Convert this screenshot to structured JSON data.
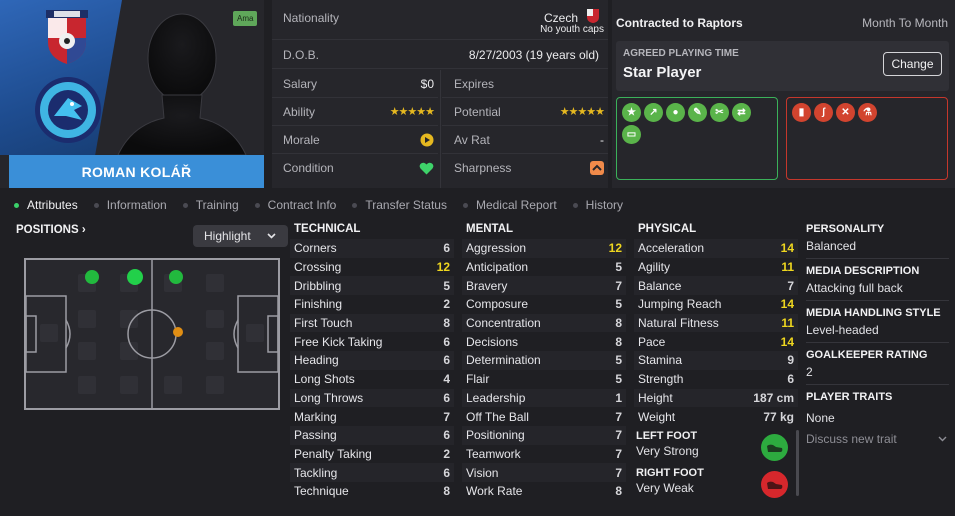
{
  "player": {
    "name": "ROMAN KOLÁŘ",
    "tag": "Ama"
  },
  "info": {
    "nationality_label": "Nationality",
    "nationality": "Czech",
    "caps": "No youth caps",
    "dob_label": "D.O.B.",
    "dob": "8/27/2003 (19 years old)",
    "salary_label": "Salary",
    "salary": "$0",
    "expires_label": "Expires",
    "ability_label": "Ability",
    "potential_label": "Potential",
    "ability_stars": "★★★★★",
    "potential_stars": "★★★★★",
    "morale_label": "Morale",
    "avrat_label": "Av Rat",
    "avrat": "-",
    "condition_label": "Condition",
    "sharpness_label": "Sharpness"
  },
  "contract": {
    "title": "Contracted to Raptors",
    "type": "Month To Month",
    "playing_time_label": "AGREED PLAYING TIME",
    "playing_time": "Star Player",
    "change_label": "Change"
  },
  "tabs": [
    "Attributes",
    "Information",
    "Training",
    "Contract Info",
    "Transfer Status",
    "Medical Report",
    "History"
  ],
  "positions": {
    "title": "POSITIONS ›",
    "highlight": "Highlight"
  },
  "technical": {
    "header": "TECHNICAL",
    "rows": [
      {
        "name": "Corners",
        "value": "6",
        "hl": false
      },
      {
        "name": "Crossing",
        "value": "12",
        "hl": true
      },
      {
        "name": "Dribbling",
        "value": "5",
        "hl": false
      },
      {
        "name": "Finishing",
        "value": "2",
        "hl": false
      },
      {
        "name": "First Touch",
        "value": "8",
        "hl": false
      },
      {
        "name": "Free Kick Taking",
        "value": "6",
        "hl": false
      },
      {
        "name": "Heading",
        "value": "6",
        "hl": false
      },
      {
        "name": "Long Shots",
        "value": "4",
        "hl": false
      },
      {
        "name": "Long Throws",
        "value": "6",
        "hl": false
      },
      {
        "name": "Marking",
        "value": "7",
        "hl": false
      },
      {
        "name": "Passing",
        "value": "6",
        "hl": false
      },
      {
        "name": "Penalty Taking",
        "value": "2",
        "hl": false
      },
      {
        "name": "Tackling",
        "value": "6",
        "hl": false
      },
      {
        "name": "Technique",
        "value": "8",
        "hl": false
      }
    ]
  },
  "mental": {
    "header": "MENTAL",
    "rows": [
      {
        "name": "Aggression",
        "value": "12",
        "hl": true
      },
      {
        "name": "Anticipation",
        "value": "5",
        "hl": false
      },
      {
        "name": "Bravery",
        "value": "7",
        "hl": false
      },
      {
        "name": "Composure",
        "value": "5",
        "hl": false
      },
      {
        "name": "Concentration",
        "value": "8",
        "hl": false
      },
      {
        "name": "Decisions",
        "value": "8",
        "hl": false
      },
      {
        "name": "Determination",
        "value": "5",
        "hl": false
      },
      {
        "name": "Flair",
        "value": "5",
        "hl": false
      },
      {
        "name": "Leadership",
        "value": "1",
        "hl": false
      },
      {
        "name": "Off The Ball",
        "value": "7",
        "hl": false
      },
      {
        "name": "Positioning",
        "value": "7",
        "hl": false
      },
      {
        "name": "Teamwork",
        "value": "7",
        "hl": false
      },
      {
        "name": "Vision",
        "value": "7",
        "hl": false
      },
      {
        "name": "Work Rate",
        "value": "8",
        "hl": false
      }
    ]
  },
  "physical": {
    "header": "PHYSICAL",
    "rows": [
      {
        "name": "Acceleration",
        "value": "14",
        "hl": true
      },
      {
        "name": "Agility",
        "value": "11",
        "hl": true
      },
      {
        "name": "Balance",
        "value": "7",
        "hl": false
      },
      {
        "name": "Jumping Reach",
        "value": "14",
        "hl": true
      },
      {
        "name": "Natural Fitness",
        "value": "11",
        "hl": true
      },
      {
        "name": "Pace",
        "value": "14",
        "hl": true
      },
      {
        "name": "Stamina",
        "value": "9",
        "hl": false
      },
      {
        "name": "Strength",
        "value": "6",
        "hl": false
      },
      {
        "name": "Height",
        "value": "187 cm",
        "hl": false
      },
      {
        "name": "Weight",
        "value": "77 kg",
        "hl": false
      }
    ]
  },
  "feet": {
    "left_label": "LEFT FOOT",
    "left_value": "Very Strong",
    "right_label": "RIGHT FOOT",
    "right_value": "Very Weak"
  },
  "right": {
    "personality_label": "PERSONALITY",
    "personality": "Balanced",
    "media_desc_label": "MEDIA DESCRIPTION",
    "media_desc": "Attacking full back",
    "media_style_label": "MEDIA HANDLING STYLE",
    "media_style": "Level-headed",
    "gk_label": "GOALKEEPER RATING",
    "gk": "2",
    "traits_label": "PLAYER TRAITS",
    "traits": "None",
    "discuss": "Discuss new trait"
  },
  "colors": {
    "accent": "#3a8fd8",
    "good": "#5ab44a",
    "bad": "#d2442f",
    "highlight": "#eed61f"
  }
}
